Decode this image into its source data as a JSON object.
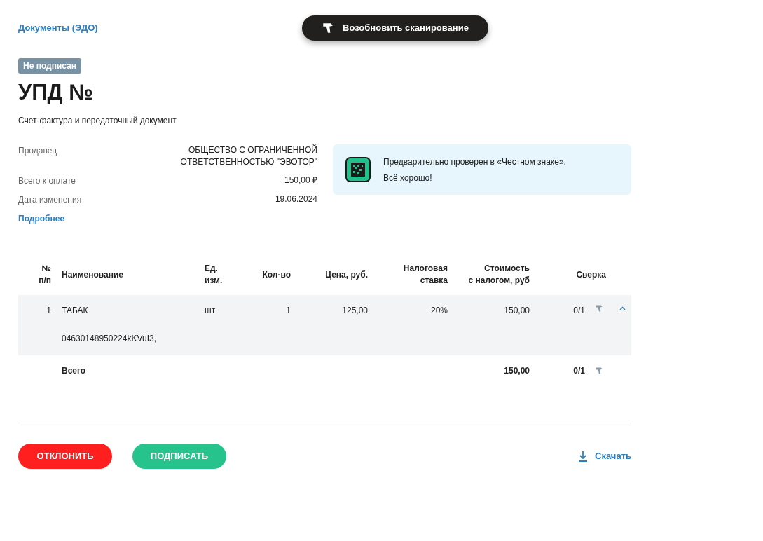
{
  "breadcrumb": "Документы (ЭДО)",
  "scan_button": "Возобновить сканирование",
  "status_badge": "Не подписан",
  "title": "УПД №",
  "subtitle": "Счет-фактура и передаточный документ",
  "details": [
    {
      "label": "Продавец",
      "value": "ОБЩЕСТВО С ОГРАНИЧЕННОЙ ОТВЕТСТВЕННОСТЬЮ \"ЭВОТОР\""
    },
    {
      "label": "Всего к оплате",
      "value": "150,00 ₽"
    },
    {
      "label": "Дата изменения",
      "value": "19.06.2024"
    }
  ],
  "more_link": "Подробнее",
  "check_notice": {
    "lines": [
      "Предварительно проверен в «Честном знаке».",
      "Всё хорошо!"
    ]
  },
  "table": {
    "columns": [
      "№\nп/п",
      "Наименование",
      "Ед.\nизм.",
      "Кол-во",
      "Цена, руб.",
      "Налоговая\nставка",
      "Стоимость\nс налогом, руб",
      "Сверка"
    ],
    "rows": [
      {
        "number": "1",
        "name": "ТАБАК",
        "code": "04630148950224kKVuI3,",
        "unit": "шт",
        "qty": "1",
        "price": "125,00",
        "tax": "20%",
        "cost": "150,00",
        "check": "0/1",
        "expanded": true
      }
    ],
    "total": {
      "label": "Всего",
      "cost": "150,00",
      "check": "0/1"
    }
  },
  "buttons": {
    "reject": "ОТКЛОНИТЬ",
    "sign": "ПОДПИСАТЬ",
    "download": "Скачать"
  }
}
